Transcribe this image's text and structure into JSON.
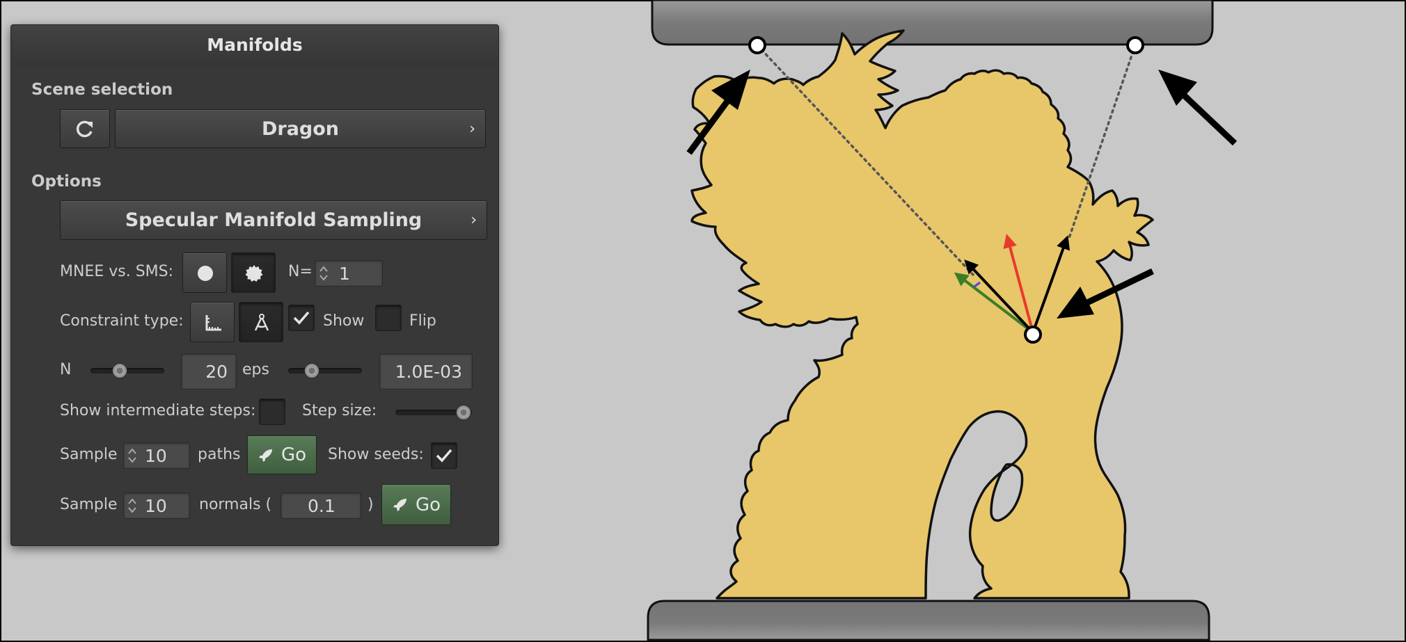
{
  "panel": {
    "title": "Manifolds",
    "scene_section": "Scene selection",
    "scene_name": "Dragon",
    "options_section": "Options",
    "method": "Specular Manifold Sampling",
    "mnee_label": "MNEE vs. SMS:",
    "n_eq_label": "N=",
    "n_eq_value": "1",
    "constraint_label": "Constraint type:",
    "show_label": "Show",
    "show_checked": true,
    "flip_label": "Flip",
    "flip_checked": false,
    "n_label": "N",
    "n_value": "20",
    "n_slider_fraction": 0.4,
    "eps_label": "eps",
    "eps_value": "1.0E-03",
    "eps_slider_fraction": 0.3,
    "show_steps_label": "Show intermediate steps:",
    "show_steps_checked": false,
    "step_size_label": "Step size:",
    "step_size_fraction": 1.0,
    "sample_label_1": "Sample",
    "paths_count": "10",
    "paths_label": "paths",
    "go_label": "Go",
    "show_seeds_label": "Show seeds:",
    "show_seeds_checked": true,
    "sample_label_2": "Sample",
    "normals_count": "10",
    "normals_label": "normals (",
    "normals_value": "0.1",
    "normals_close": ")",
    "go_label_2": "Go"
  },
  "scene": {
    "object_color": "#e8c66a",
    "plate_color": "#777777",
    "background_color": "#c8c8c8",
    "normal_vector_color": "#e83a2a",
    "tangent_vector_color": "#3a7e2a",
    "icons": [
      "refresh-icon",
      "chevron-right-icon",
      "circle-icon",
      "rough-circle-icon",
      "angle-ruler-icon",
      "compass-icon",
      "check-icon",
      "rocket-icon",
      "spinner-icon"
    ]
  }
}
